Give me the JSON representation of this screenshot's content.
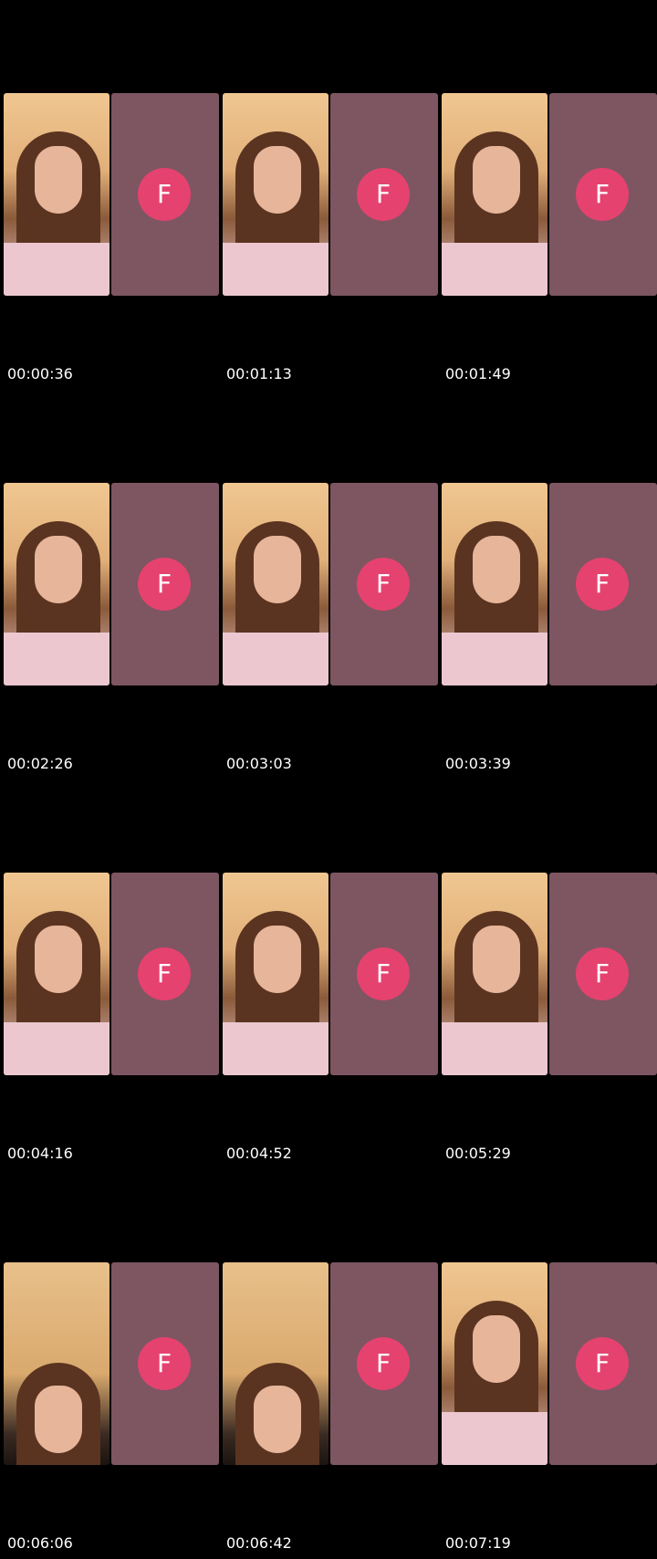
{
  "avatar": {
    "letter": "F",
    "color": "#e5426f",
    "panel_color": "#7d5662"
  },
  "thumbnails": [
    {
      "time": "00:00:36"
    },
    {
      "time": "00:01:13"
    },
    {
      "time": "00:01:49"
    },
    {
      "time": "00:02:26"
    },
    {
      "time": "00:03:03"
    },
    {
      "time": "00:03:39"
    },
    {
      "time": "00:04:16"
    },
    {
      "time": "00:04:52"
    },
    {
      "time": "00:05:29"
    },
    {
      "time": "00:06:06"
    },
    {
      "time": "00:06:42"
    },
    {
      "time": "00:07:19"
    }
  ]
}
